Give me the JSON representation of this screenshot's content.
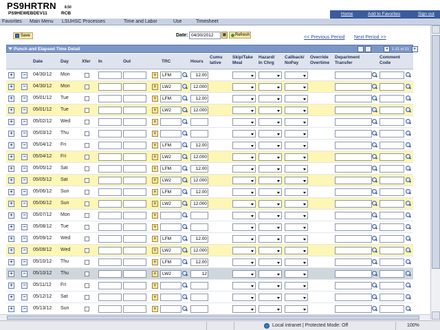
{
  "header": {
    "title": "PS9HRTRN",
    "version": "8.50",
    "db": "PS9HEWEBDEV11",
    "user": "RCB",
    "links": [
      "Home",
      "Add to Favorites",
      "Sign out"
    ]
  },
  "breadcrumb": [
    "Favorites",
    "Main Menu",
    "LSUHSC Processes",
    "Time and Labor",
    "Use",
    "Timesheet"
  ],
  "toolbar": {
    "save_label": "Save",
    "date_label": "Date:",
    "date_value": "04/30/2012",
    "refresh_label": "Refresh",
    "prev_link": "<< Previous Period",
    "next_link": "Next Period >>"
  },
  "grid": {
    "title": "Punch and Elapsed Time Detail",
    "nav_text": "1-21 of 21",
    "columns": {
      "date": "Date",
      "day": "Day",
      "xfer": "Xfer",
      "in": "In",
      "out": "Out",
      "trc": "TRC",
      "hours": "Hours",
      "cumulative": "Cumu\nlative",
      "skip": "Skip/Take\nMeal",
      "hazard": "Hazard/\nIn Chrg",
      "callback": "Callback/\nNoPay",
      "override": "Override\nOvertime",
      "dept": "Department\nTransfer",
      "comment": "Comment\nCode"
    },
    "rows": [
      {
        "date": "04/30/12",
        "day": "Mon",
        "trc": "LFM",
        "hours": "12.00",
        "style": "plain"
      },
      {
        "date": "04/30/12",
        "day": "Mon",
        "trc": "LW2",
        "hours": "12.000",
        "style": "hl"
      },
      {
        "date": "05/01/12",
        "day": "Tue",
        "trc": "LFM",
        "hours": "12.00",
        "style": "plain"
      },
      {
        "date": "05/01/12",
        "day": "Tue",
        "trc": "LW2",
        "hours": "12.000",
        "style": "hl"
      },
      {
        "date": "05/02/12",
        "day": "Wed",
        "trc": "",
        "hours": "",
        "style": "plain"
      },
      {
        "date": "05/03/12",
        "day": "Thu",
        "trc": "",
        "hours": "",
        "style": "plain"
      },
      {
        "date": "05/04/12",
        "day": "Fri",
        "trc": "LFM",
        "hours": "12.00",
        "style": "plain"
      },
      {
        "date": "05/04/12",
        "day": "Fri",
        "trc": "LW2",
        "hours": "12.000",
        "style": "hl"
      },
      {
        "date": "05/05/12",
        "day": "Sat",
        "trc": "LFM",
        "hours": "12.00",
        "style": "plain"
      },
      {
        "date": "05/05/12",
        "day": "Sat",
        "trc": "LW2",
        "hours": "12.000",
        "style": "hl"
      },
      {
        "date": "05/06/12",
        "day": "Sun",
        "trc": "LFM",
        "hours": "12.00",
        "style": "plain"
      },
      {
        "date": "05/06/12",
        "day": "Sun",
        "trc": "LW2",
        "hours": "12.000",
        "style": "hl"
      },
      {
        "date": "05/07/12",
        "day": "Mon",
        "trc": "",
        "hours": "",
        "style": "plain"
      },
      {
        "date": "05/08/12",
        "day": "Tue",
        "trc": "",
        "hours": "",
        "style": "plain"
      },
      {
        "date": "05/09/12",
        "day": "Wed",
        "trc": "LFM",
        "hours": "12.00",
        "style": "plain"
      },
      {
        "date": "05/09/12",
        "day": "Wed",
        "trc": "LW2",
        "hours": "12.000",
        "style": "hl"
      },
      {
        "date": "05/10/12",
        "day": "Thu",
        "trc": "LFM",
        "hours": "12.00",
        "style": "plain"
      },
      {
        "date": "05/10/12",
        "day": "Thu",
        "trc": "LW2",
        "hours": "12",
        "style": "sel"
      },
      {
        "date": "05/11/12",
        "day": "Fri",
        "trc": "",
        "hours": "",
        "style": "plain"
      },
      {
        "date": "05/12/12",
        "day": "Sat",
        "trc": "",
        "hours": "",
        "style": "plain"
      },
      {
        "date": "05/13/12",
        "day": "Sun",
        "trc": "",
        "hours": "",
        "style": "plain"
      }
    ]
  },
  "status": {
    "zone": "Local intranet | Protected Mode: Off",
    "zoom": "100%"
  },
  "colors": {
    "grid_header": "#7b96c7",
    "row_highlight": "#fdf6b5",
    "link_blue": "#2f4fa0"
  }
}
